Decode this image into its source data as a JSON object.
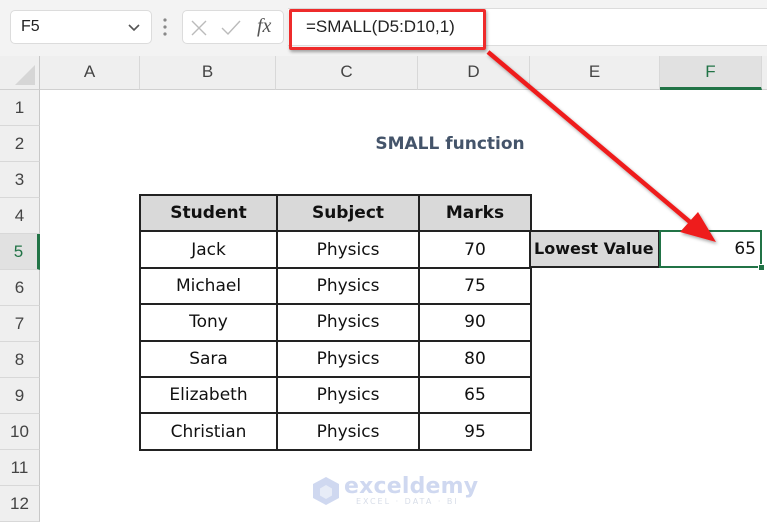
{
  "formula_bar": {
    "name_box": "F5",
    "cancel_icon": "x-icon",
    "enter_icon": "check-icon",
    "fx_label": "fx",
    "formula": "=SMALL(D5:D10,1)",
    "highlight_color": "#ee2b2b"
  },
  "columns": [
    "A",
    "B",
    "C",
    "D",
    "E",
    "F"
  ],
  "rows": [
    "1",
    "2",
    "3",
    "4",
    "5",
    "6",
    "7",
    "8",
    "9",
    "10",
    "11",
    "12"
  ],
  "selected_cell": {
    "column": "F",
    "row": "5"
  },
  "sheet": {
    "title": "SMALL function",
    "table": {
      "headers": [
        "Student",
        "Subject",
        "Marks"
      ],
      "rows": [
        [
          "Jack",
          "Physics",
          "70"
        ],
        [
          "Michael",
          "Physics",
          "75"
        ],
        [
          "Tony",
          "Physics",
          "90"
        ],
        [
          "Sara",
          "Physics",
          "80"
        ],
        [
          "Elizabeth",
          "Physics",
          "65"
        ],
        [
          "Christian",
          "Physics",
          "95"
        ]
      ]
    },
    "result_label": "Lowest Value",
    "result_value": "65"
  },
  "annotation": {
    "arrow_color": "#ee2b2b",
    "from": "formula",
    "to": "F5"
  },
  "watermark": {
    "brand": "exceldemy",
    "tagline": "EXCEL · DATA · BI"
  },
  "colors": {
    "accent": "#217346",
    "header_fill": "#d9d9d9",
    "title_text": "#44546a"
  }
}
